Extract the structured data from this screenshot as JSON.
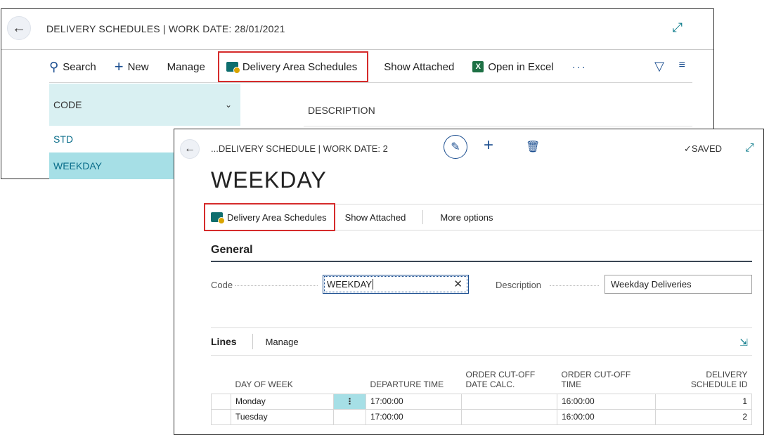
{
  "list_page": {
    "title": "DELIVERY SCHEDULES | WORK DATE: 28/01/2021",
    "actions": {
      "search": "Search",
      "new": "New",
      "manage": "Manage",
      "delivery_area_schedules": "Delivery Area Schedules",
      "show_attached": "Show Attached",
      "open_in_excel": "Open in Excel",
      "more": "···"
    },
    "columns": {
      "code": "CODE",
      "description": "DESCRIPTION"
    },
    "rows": [
      "STD",
      "WEEKDAY"
    ],
    "selected_row": "WEEKDAY"
  },
  "card_page": {
    "title": "...DELIVERY SCHEDULE | WORK DATE: 2",
    "saved_status": "SAVED",
    "heading": "WEEKDAY",
    "actions": {
      "delivery_area_schedules": "Delivery Area Schedules",
      "show_attached": "Show Attached",
      "more_options": "More options"
    },
    "general": {
      "title": "General",
      "code_label": "Code",
      "code_value": "WEEKDAY",
      "description_label": "Description",
      "description_value": "Weekday Deliveries"
    },
    "lines": {
      "title": "Lines",
      "manage": "Manage",
      "headers": {
        "day_of_week": "DAY OF WEEK",
        "departure_time": "DEPARTURE TIME",
        "order_cutoff_date_calc_1": "ORDER CUT-OFF",
        "order_cutoff_date_calc_2": "DATE CALC.",
        "order_cutoff_time_1": "ORDER CUT-OFF",
        "order_cutoff_time_2": "TIME",
        "delivery_schedule_id_1": "DELIVERY",
        "delivery_schedule_id_2": "SCHEDULE ID"
      },
      "rows": [
        {
          "day_of_week": "Monday",
          "departure_time": "17:00:00",
          "order_cutoff_date_calc": "",
          "order_cutoff_time": "16:00:00",
          "delivery_schedule_id": "1"
        },
        {
          "day_of_week": "Tuesday",
          "departure_time": "17:00:00",
          "order_cutoff_date_calc": "",
          "order_cutoff_time": "16:00:00",
          "delivery_schedule_id": "2"
        }
      ]
    }
  },
  "icons": {
    "back": "back-arrow-icon",
    "search": "search-icon",
    "new": "plus-icon",
    "filter": "filter-icon",
    "list_view": "list-view-icon",
    "expand": "expand-icon",
    "edit": "pencil-icon",
    "delete": "trash-icon",
    "saved": "checkmark-icon"
  },
  "colors": {
    "accent": "#1a4d8f",
    "selection": "#a6dfe6",
    "header_highlight": "#d9f0f2",
    "callout_red": "#d52b2b",
    "excel_green": "#1d7044"
  }
}
